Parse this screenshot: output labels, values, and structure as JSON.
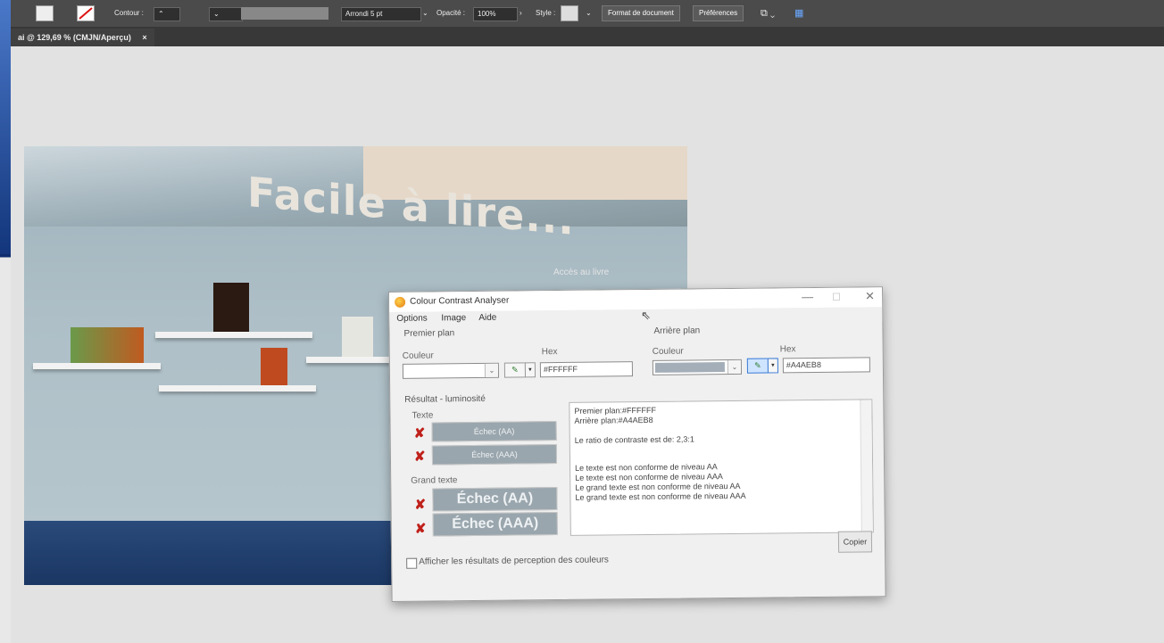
{
  "toolbar": {
    "contour_label": "Contour :",
    "stroke_style": "Arrondi 5 pt",
    "opacity_label": "Opacité :",
    "opacity_value": "100%",
    "style_label": "Style :",
    "doc_format_button": "Format de document",
    "preferences_button": "Préférences"
  },
  "document_tab": {
    "title": "ai @ 129,69 % (CMJN/Aperçu)",
    "close": "×"
  },
  "artwork": {
    "heading": "Facile à lire...",
    "subtitle": "Accès au livre"
  },
  "cca": {
    "title": "Colour Contrast Analyser",
    "window_controls": {
      "minimize": "—",
      "maximize": "☐",
      "close": "✕"
    },
    "menu": [
      "Options",
      "Image",
      "Aide"
    ],
    "foreground": {
      "group_label": "Premier plan",
      "color_label": "Couleur",
      "hex_label": "Hex",
      "hex_value": "#FFFFFF",
      "swatch_color": "#FFFFFF"
    },
    "background": {
      "group_label": "Arrière plan",
      "color_label": "Couleur",
      "hex_label": "Hex",
      "hex_value": "#A4AEB8",
      "swatch_color": "#A4AEB8"
    },
    "results": {
      "group_label": "Résultat - luminosité",
      "text_label": "Texte",
      "large_text_label": "Grand texte",
      "text_aa": "Échec (AA)",
      "text_aaa": "Échec (AAA)",
      "large_aa": "Échec (AA)",
      "large_aaa": "Échec (AAA)",
      "fail_mark": "✘"
    },
    "report_lines": [
      "Premier plan:#FFFFFF",
      "Arrière plan:#A4AEB8",
      "",
      "Le ratio de contraste est de: 2,3:1",
      "",
      "Le texte est non conforme de niveau AA",
      "Le texte est non conforme de niveau AAA",
      "Le grand texte est non conforme de niveau AA",
      "Le grand texte est non conforme de niveau AAA"
    ],
    "copy_button": "Copier",
    "perception_checkbox_label": "Afficher les résultats de perception des couleurs",
    "perception_checked": false
  }
}
